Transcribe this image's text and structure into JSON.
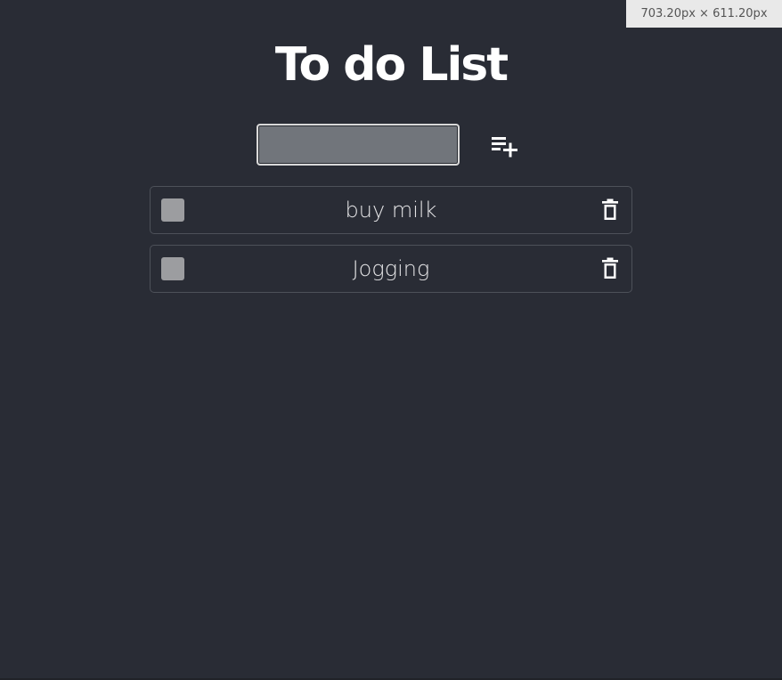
{
  "viewport_badge": "703.20px × 611.20px",
  "title": "To do List",
  "input": {
    "value": "",
    "placeholder": ""
  },
  "add_button": {
    "icon": "playlist-add-icon"
  },
  "todos": [
    {
      "text": "buy milk",
      "checked": false,
      "delete_icon": "trash-icon"
    },
    {
      "text": "Jogging",
      "checked": false,
      "delete_icon": "trash-icon"
    }
  ],
  "colors": {
    "background": "#292c35",
    "input_background": "#71757b",
    "checkbox": "#9c9da0",
    "item_border": "#4d5159",
    "text": "#ffffff"
  }
}
